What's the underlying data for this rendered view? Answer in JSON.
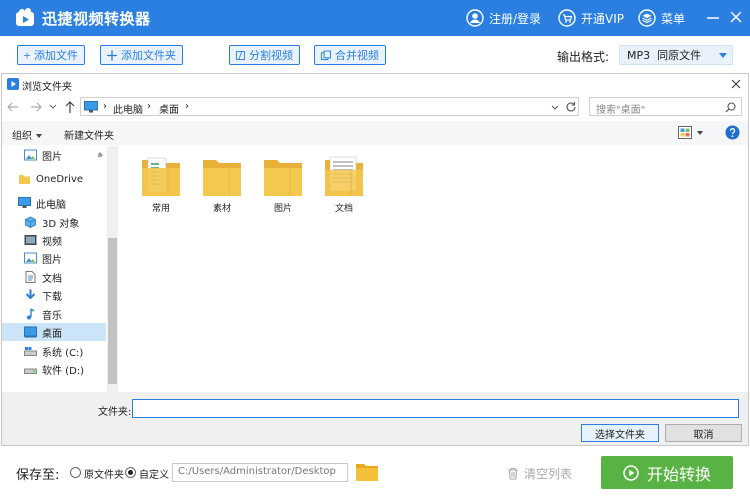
{
  "app": {
    "title": "迅捷视频转换器",
    "login_label": "注册/登录",
    "vip_label": "开通VIP",
    "menu_label": "菜单"
  },
  "toolbar": {
    "add_file": "添加文件",
    "add_folder": "添加文件夹",
    "split_video": "分割视频",
    "merge_video": "合并视频",
    "output_format_label": "输出格式:",
    "output_format_value": "MP3  同原文件"
  },
  "dialog": {
    "title": "浏览文件夹",
    "breadcrumb": [
      "此电脑",
      "桌面"
    ],
    "search_placeholder": "搜索\"桌面\"",
    "organize": "组织",
    "new_folder": "新建文件夹",
    "nav_items": [
      {
        "label": "图片",
        "icon": "pictures-icon"
      },
      {
        "label": "OneDrive",
        "icon": "onedrive-icon"
      },
      {
        "label": "此电脑",
        "icon": "pc-icon"
      },
      {
        "label": "3D 对象",
        "icon": "3d-objects-icon"
      },
      {
        "label": "视频",
        "icon": "videos-icon"
      },
      {
        "label": "图片",
        "icon": "pictures-icon"
      },
      {
        "label": "文档",
        "icon": "documents-icon"
      },
      {
        "label": "下载",
        "icon": "downloads-icon"
      },
      {
        "label": "音乐",
        "icon": "music-icon"
      },
      {
        "label": "桌面",
        "icon": "desktop-icon"
      },
      {
        "label": "系统 (C:)",
        "icon": "drive-icon"
      },
      {
        "label": "软件 (D:)",
        "icon": "drive-icon"
      }
    ],
    "folders": [
      "常用",
      "素材",
      "图片",
      "文档"
    ],
    "folder_field_label": "文件夹:",
    "folder_field_value": "",
    "select_folder_button": "选择文件夹",
    "cancel_button": "取消"
  },
  "footer": {
    "save_to_label": "保存至:",
    "option_original": "原文件夹",
    "option_custom": "自定义",
    "selected_option": "custom",
    "path": "C:/Users/Administrator/Desktop",
    "clear_list": "清空列表",
    "start_convert": "开始转换"
  },
  "colors": {
    "brand_blue": "#2a7fe0",
    "start_green": "#58b344",
    "folder_yellow": "#f4c74f"
  }
}
